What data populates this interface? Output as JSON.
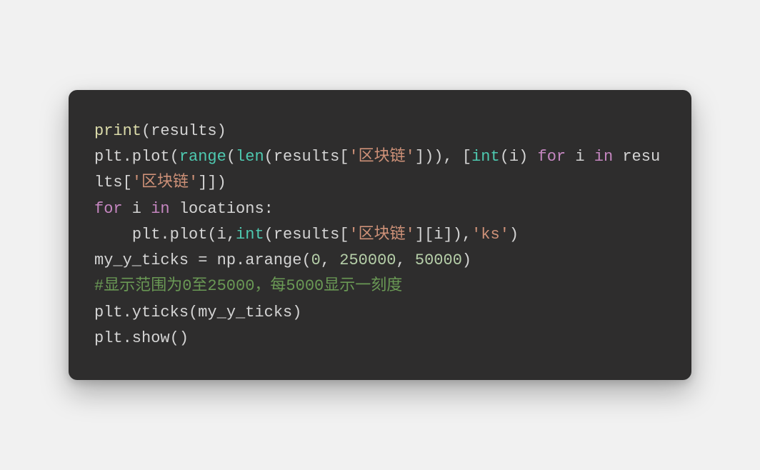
{
  "code": {
    "line1": {
      "print": "print",
      "p1": "(results)"
    },
    "line2": {
      "p1": "plt.plot(",
      "range": "range",
      "p2": "(",
      "len": "len",
      "p3": "(results[",
      "str1": "'区块链'",
      "p4": "])), [",
      "int": "int",
      "p5": "(i) ",
      "for": "for",
      "p6": " i ",
      "in": "in",
      "p7": " results[",
      "str2": "'区块链'",
      "p8": "]])"
    },
    "line3": {
      "for": "for",
      "p1": " i ",
      "in": "in",
      "p2": " locations:"
    },
    "line4": {
      "indent": "    ",
      "p1": "plt.plot(i,",
      "int": "int",
      "p2": "(results[",
      "str1": "'区块链'",
      "p3": "][i]),",
      "str2": "'ks'",
      "p4": ")"
    },
    "line5": {
      "p1": "my_y_ticks = np.arange(",
      "n1": "0",
      "c1": ", ",
      "n2": "250000",
      "c2": ", ",
      "n3": "50000",
      "p2": ")"
    },
    "line6": {
      "comment": "#显示范围为0至25000，每5000显示一刻度"
    },
    "line7": {
      "p1": "plt.yticks(my_y_ticks)"
    },
    "line8": {
      "p1": "plt.show()"
    }
  }
}
